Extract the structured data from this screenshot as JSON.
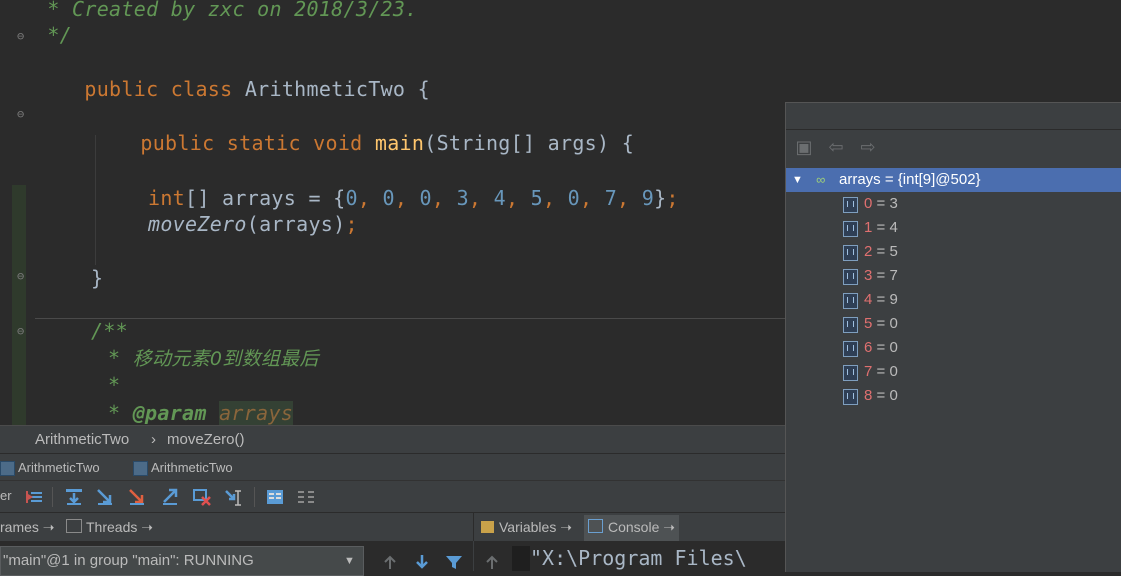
{
  "editor": {
    "lines": {
      "comment_created": " * Created by zxc on 2018/3/23.",
      "comment_end": " */",
      "class_kw": "public class",
      "class_name": "ArithmeticTwo",
      "brace_open": "{",
      "main_kw": "public static void",
      "main_name": "main",
      "main_args": "(String[] args) {",
      "int_kw": "int",
      "arr_decl": "[] arrays = {",
      "values": [
        "0",
        "0",
        "0",
        "3",
        "4",
        "5",
        "0",
        "7",
        "9"
      ],
      "arr_close": "}",
      "semi": ";",
      "call_name": "moveZero",
      "call_args": "(arrays)",
      "close_brace": "}",
      "javadoc_open": "/**",
      "javadoc_cn": "移动元素0到数组最后",
      "javadoc_star": "*",
      "param_tag": "@param",
      "param_name": "arrays"
    }
  },
  "breadcrumb": {
    "class": "ArithmeticTwo",
    "sep": "›",
    "method": "moveZero()"
  },
  "debug_tabs": [
    "ArithmeticTwo",
    "ArithmeticTwo"
  ],
  "toolbar": {
    "partial_label": "er"
  },
  "panels": {
    "frames": "rames ➝",
    "threads": "Threads ➝",
    "variables": "Variables ➝",
    "console": "Console ➝"
  },
  "thread_select": {
    "value": "\"main\"@1 in group \"main\": RUNNING",
    "arrow": "▼"
  },
  "console": {
    "text": "\"X:\\Program Files\\"
  },
  "popup": {
    "root": "arrays = {int[9]@502}",
    "items": [
      {
        "index": "0",
        "value": "3"
      },
      {
        "index": "1",
        "value": "4"
      },
      {
        "index": "2",
        "value": "5"
      },
      {
        "index": "3",
        "value": "7"
      },
      {
        "index": "4",
        "value": "9"
      },
      {
        "index": "5",
        "value": "0"
      },
      {
        "index": "6",
        "value": "0"
      },
      {
        "index": "7",
        "value": "0"
      },
      {
        "index": "8",
        "value": "0"
      }
    ]
  },
  "colors": {
    "keyword": "#cc7832",
    "number": "#6897bb",
    "function": "#ffc66d",
    "comment": "#629755",
    "selection": "#4b6eaf",
    "index_red": "#e07070"
  },
  "icons": [
    "fold-icon",
    "frames-icon",
    "class-file-icon",
    "step-over-icon",
    "step-into-icon",
    "force-step-into-icon",
    "step-out-icon",
    "drop-frame-icon",
    "run-to-cursor-icon",
    "evaluate-icon",
    "trace-icon",
    "filter-icon",
    "array-item-icon",
    "watch-icon",
    "back-arrow-icon",
    "forward-arrow-icon"
  ]
}
